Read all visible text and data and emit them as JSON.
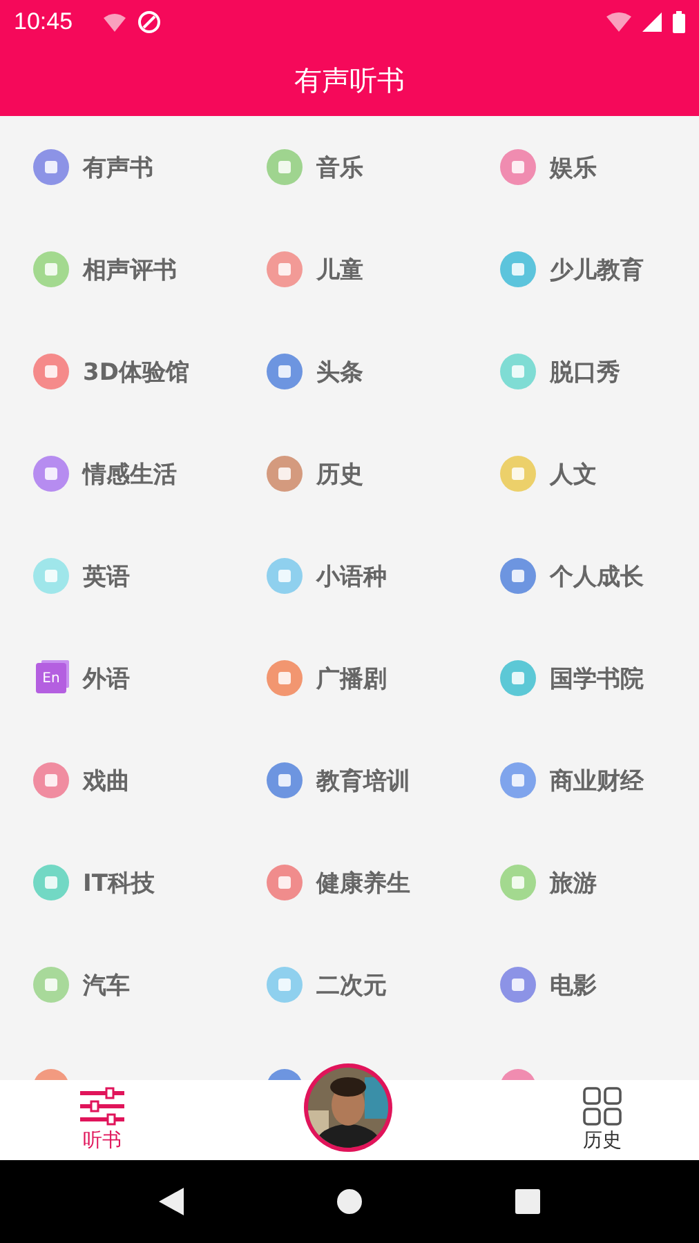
{
  "status_bar": {
    "time": "10:45"
  },
  "header": {
    "title": "有声听书"
  },
  "categories": [
    {
      "label": "有声书",
      "color": "#8c93e6",
      "kind": "circle"
    },
    {
      "label": "音乐",
      "color": "#9fd48f",
      "kind": "circle"
    },
    {
      "label": "娱乐",
      "color": "#f08cb0",
      "kind": "circle"
    },
    {
      "label": "相声评书",
      "color": "#a3d98f",
      "kind": "circle"
    },
    {
      "label": "儿童",
      "color": "#f29a96",
      "kind": "circle"
    },
    {
      "label": "少儿教育",
      "color": "#5cc4dc",
      "kind": "circle"
    },
    {
      "label": "3D体验馆",
      "color": "#f58a8a",
      "kind": "circle"
    },
    {
      "label": "头条",
      "color": "#6d95e0",
      "kind": "circle"
    },
    {
      "label": "脱口秀",
      "color": "#7fdcd4",
      "kind": "circle"
    },
    {
      "label": "情感生活",
      "color": "#b68cf0",
      "kind": "circle"
    },
    {
      "label": "历史",
      "color": "#d49a7e",
      "kind": "circle"
    },
    {
      "label": "人文",
      "color": "#ecd06a",
      "kind": "circle"
    },
    {
      "label": "英语",
      "color": "#9fe6ea",
      "kind": "circle"
    },
    {
      "label": "小语种",
      "color": "#8fd0ee",
      "kind": "circle"
    },
    {
      "label": "个人成长",
      "color": "#6d95e0",
      "kind": "circle"
    },
    {
      "label": "外语",
      "color": "#b45fe0",
      "kind": "square",
      "badge": "En"
    },
    {
      "label": "广播剧",
      "color": "#f29670",
      "kind": "circle"
    },
    {
      "label": "国学书院",
      "color": "#5cc8d6",
      "kind": "circle"
    },
    {
      "label": "戏曲",
      "color": "#f08ca0",
      "kind": "circle"
    },
    {
      "label": "教育培训",
      "color": "#6d95e0",
      "kind": "circle"
    },
    {
      "label": "商业财经",
      "color": "#7fa4ec",
      "kind": "circle"
    },
    {
      "label": "IT科技",
      "color": "#72d8c4",
      "kind": "circle"
    },
    {
      "label": "健康养生",
      "color": "#f08c8c",
      "kind": "circle"
    },
    {
      "label": "旅游",
      "color": "#a3d98f",
      "kind": "circle"
    },
    {
      "label": "汽车",
      "color": "#a8d99a",
      "kind": "circle"
    },
    {
      "label": "二次元",
      "color": "#8fd0ee",
      "kind": "circle"
    },
    {
      "label": "电影",
      "color": "#8c93e6",
      "kind": "circle"
    }
  ],
  "partial_row": [
    {
      "color": "#f29a80"
    },
    {
      "color": "#6d95e0"
    },
    {
      "color": "#f08cb0"
    }
  ],
  "bottom_tabs": [
    {
      "label": "听书",
      "selected": true,
      "kind": "sliders"
    },
    {
      "kind": "avatar"
    },
    {
      "label": "历史",
      "selected": false,
      "kind": "grid"
    }
  ]
}
